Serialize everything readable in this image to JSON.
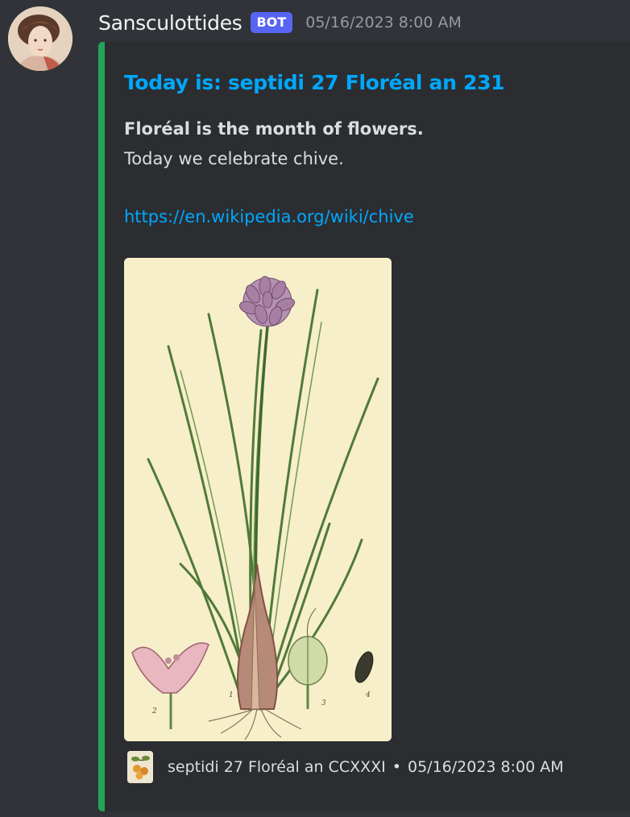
{
  "message": {
    "username": "Sansculottides",
    "badge": "BOT",
    "timestamp": "05/16/2023 8:00 AM",
    "avatar_icon": "portrait-avatar-icon"
  },
  "embed": {
    "accent_color": "#23a559",
    "title": "Today is: septidi 27 Floréal an 231",
    "description_bold": "Floréal is the month of flowers.",
    "description_line": "Today we celebrate chive.",
    "link": "https://en.wikipedia.org/wiki/chive",
    "image": {
      "subject": "chive botanical illustration",
      "figure_labels": [
        "1",
        "2",
        "3",
        "4"
      ]
    },
    "footer": {
      "icon": "fruit-branch-icon",
      "text": "septidi 27 Floréal an CCXXXI",
      "separator": "•",
      "timestamp": "05/16/2023 8:00 AM"
    }
  },
  "colors": {
    "background": "#313338",
    "embed_background": "#2b2d31",
    "link": "#00a8fc",
    "bot_badge": "#5865f2"
  }
}
